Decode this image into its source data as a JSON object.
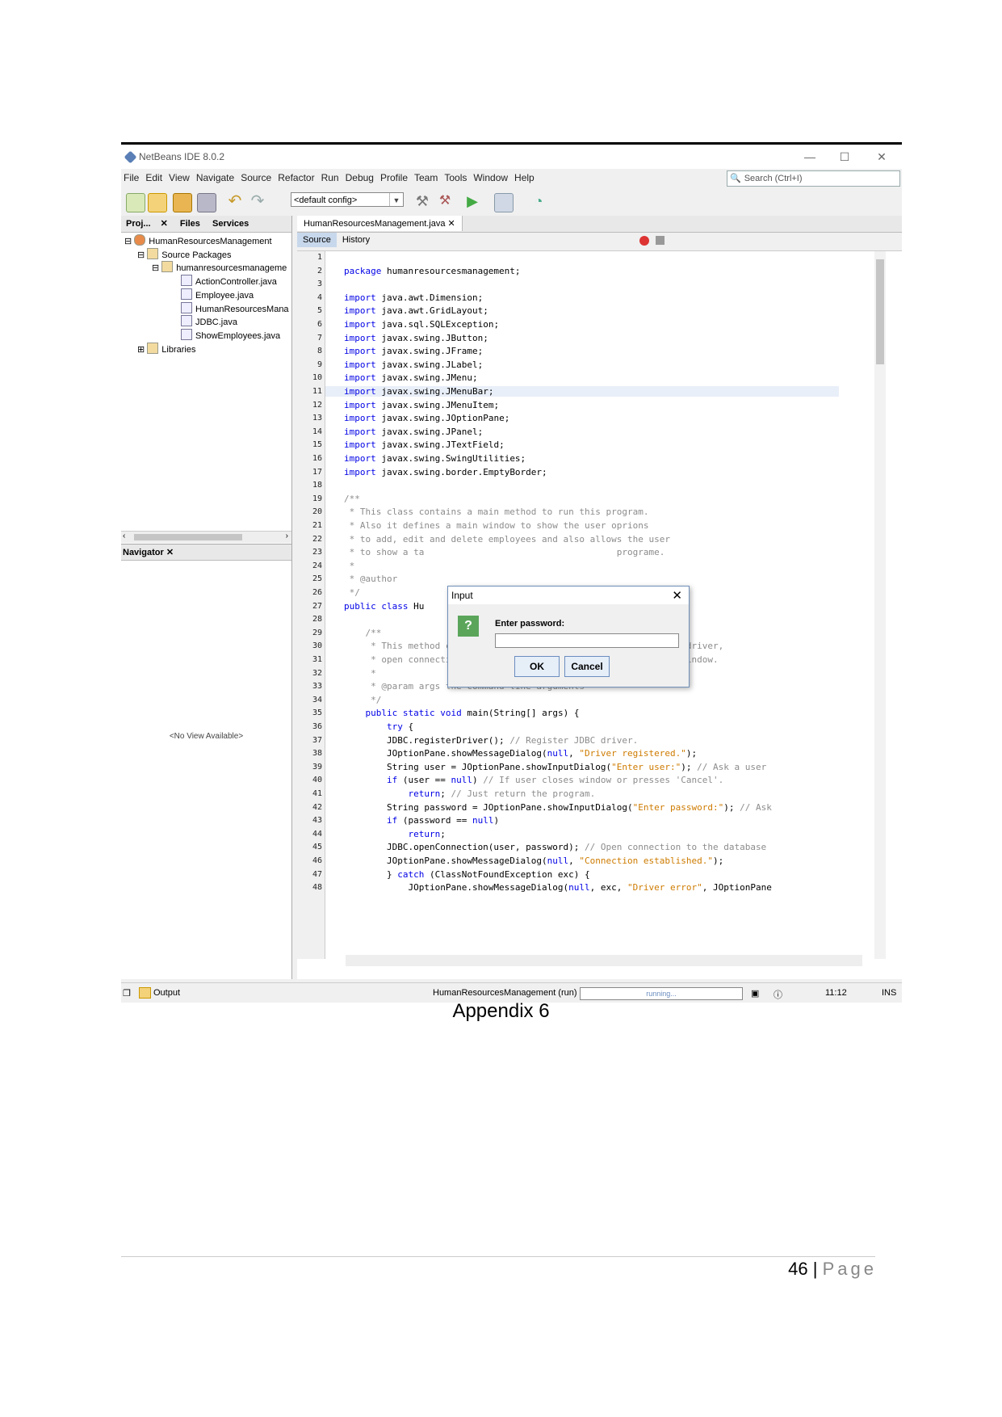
{
  "window": {
    "title": "NetBeans IDE 8.0.2",
    "minimize": "—",
    "maximize": "☐",
    "close": "✕"
  },
  "menu": [
    "File",
    "Edit",
    "View",
    "Navigate",
    "Source",
    "Refactor",
    "Run",
    "Debug",
    "Profile",
    "Team",
    "Tools",
    "Window",
    "Help"
  ],
  "search": {
    "placeholder": "Search (Ctrl+I)"
  },
  "toolbar": {
    "config": "<default config>"
  },
  "left_tabs": [
    "Proj...",
    "Files",
    "Services"
  ],
  "tree": {
    "project": "HumanResourcesManagement",
    "source_packages": "Source Packages",
    "package": "humanresourcesmanageme",
    "files": [
      "ActionController.java",
      "Employee.java",
      "HumanResourcesMana",
      "JDBC.java",
      "ShowEmployees.java"
    ],
    "libraries": "Libraries"
  },
  "navigator": {
    "title": "Navigator",
    "empty": "<No View Available>"
  },
  "editor": {
    "tab": "HumanResourcesManagement.java",
    "source_btn": "Source",
    "history_btn": "History",
    "lines": [
      {
        "n": "1",
        "t": ""
      },
      {
        "n": "2",
        "t": "package humanresourcesmanagement;"
      },
      {
        "n": "3",
        "t": ""
      },
      {
        "n": "4",
        "t": "import java.awt.Dimension;"
      },
      {
        "n": "5",
        "t": "import java.awt.GridLayout;"
      },
      {
        "n": "6",
        "t": "import java.sql.SQLException;"
      },
      {
        "n": "7",
        "t": "import javax.swing.JButton;"
      },
      {
        "n": "8",
        "t": "import javax.swing.JFrame;"
      },
      {
        "n": "9",
        "t": "import javax.swing.JLabel;"
      },
      {
        "n": "10",
        "t": "import javax.swing.JMenu;"
      },
      {
        "n": "11",
        "t": "import javax.swing.JMenuBar;"
      },
      {
        "n": "12",
        "t": "import javax.swing.JMenuItem;"
      },
      {
        "n": "13",
        "t": "import javax.swing.JOptionPane;"
      },
      {
        "n": "14",
        "t": "import javax.swing.JPanel;"
      },
      {
        "n": "15",
        "t": "import javax.swing.JTextField;"
      },
      {
        "n": "16",
        "t": "import javax.swing.SwingUtilities;"
      },
      {
        "n": "17",
        "t": "import javax.swing.border.EmptyBorder;"
      },
      {
        "n": "18",
        "t": ""
      },
      {
        "n": "19",
        "t": "/**"
      },
      {
        "n": "20",
        "t": " * This class contains a main method to run this program."
      },
      {
        "n": "21",
        "t": " * Also it defines a main window to show the user oprions"
      },
      {
        "n": "22",
        "t": " * to add, edit and delete employees and also allows the user"
      },
      {
        "n": "23",
        "t": " * to show a ta                                    programe."
      },
      {
        "n": "24",
        "t": " *"
      },
      {
        "n": "25",
        "t": " * @author"
      },
      {
        "n": "26",
        "t": " */"
      },
      {
        "n": "27",
        "t": "public class Hu                                     {"
      },
      {
        "n": "28",
        "t": ""
      },
      {
        "n": "29",
        "t": "    /**"
      },
      {
        "n": "30",
        "t": "     * This method calls methods of JDBC class to register JDBC driver,"
      },
      {
        "n": "31",
        "t": "     * open connection to database 'Employees' and show a main window."
      },
      {
        "n": "32",
        "t": "     *"
      },
      {
        "n": "33",
        "t": "     * @param args the command line arguments"
      },
      {
        "n": "34",
        "t": "     */"
      },
      {
        "n": "35",
        "t": "    public static void main(String[] args) {"
      },
      {
        "n": "36",
        "t": "        try {"
      },
      {
        "n": "37",
        "t": "        JDBC.registerDriver(); // Register JDBC driver."
      },
      {
        "n": "38",
        "t": "        JOptionPane.showMessageDialog(null, \"Driver registered.\");"
      },
      {
        "n": "39",
        "t": "        String user = JOptionPane.showInputDialog(\"Enter user:\"); // Ask a user"
      },
      {
        "n": "40",
        "t": "        if (user == null) // If user closes window or presses 'Cancel'."
      },
      {
        "n": "41",
        "t": "            return; // Just return the program."
      },
      {
        "n": "42",
        "t": "        String password = JOptionPane.showInputDialog(\"Enter password:\"); // Ask"
      },
      {
        "n": "43",
        "t": "        if (password == null)"
      },
      {
        "n": "44",
        "t": "            return;"
      },
      {
        "n": "45",
        "t": "        JDBC.openConnection(user, password); // Open connection to the database"
      },
      {
        "n": "46",
        "t": "        JOptionPane.showMessageDialog(null, \"Connection established.\");"
      },
      {
        "n": "47",
        "t": "        } catch (ClassNotFoundException exc) {"
      },
      {
        "n": "48",
        "t": "            JOptionPane.showMessageDialog(null, exc, \"Driver error\", JOptionPane"
      }
    ]
  },
  "dialog": {
    "title": "Input",
    "close": "✕",
    "icon": "?",
    "label": "Enter password:",
    "ok": "OK",
    "cancel": "Cancel"
  },
  "status": {
    "output": "Output",
    "running_task": "HumanResourcesManagement (run)",
    "progress": "running...",
    "position": "11:12",
    "mode": "INS"
  },
  "caption": "Appendix 6",
  "footer": {
    "page": "46",
    "sep": "|",
    "word": "Page"
  }
}
